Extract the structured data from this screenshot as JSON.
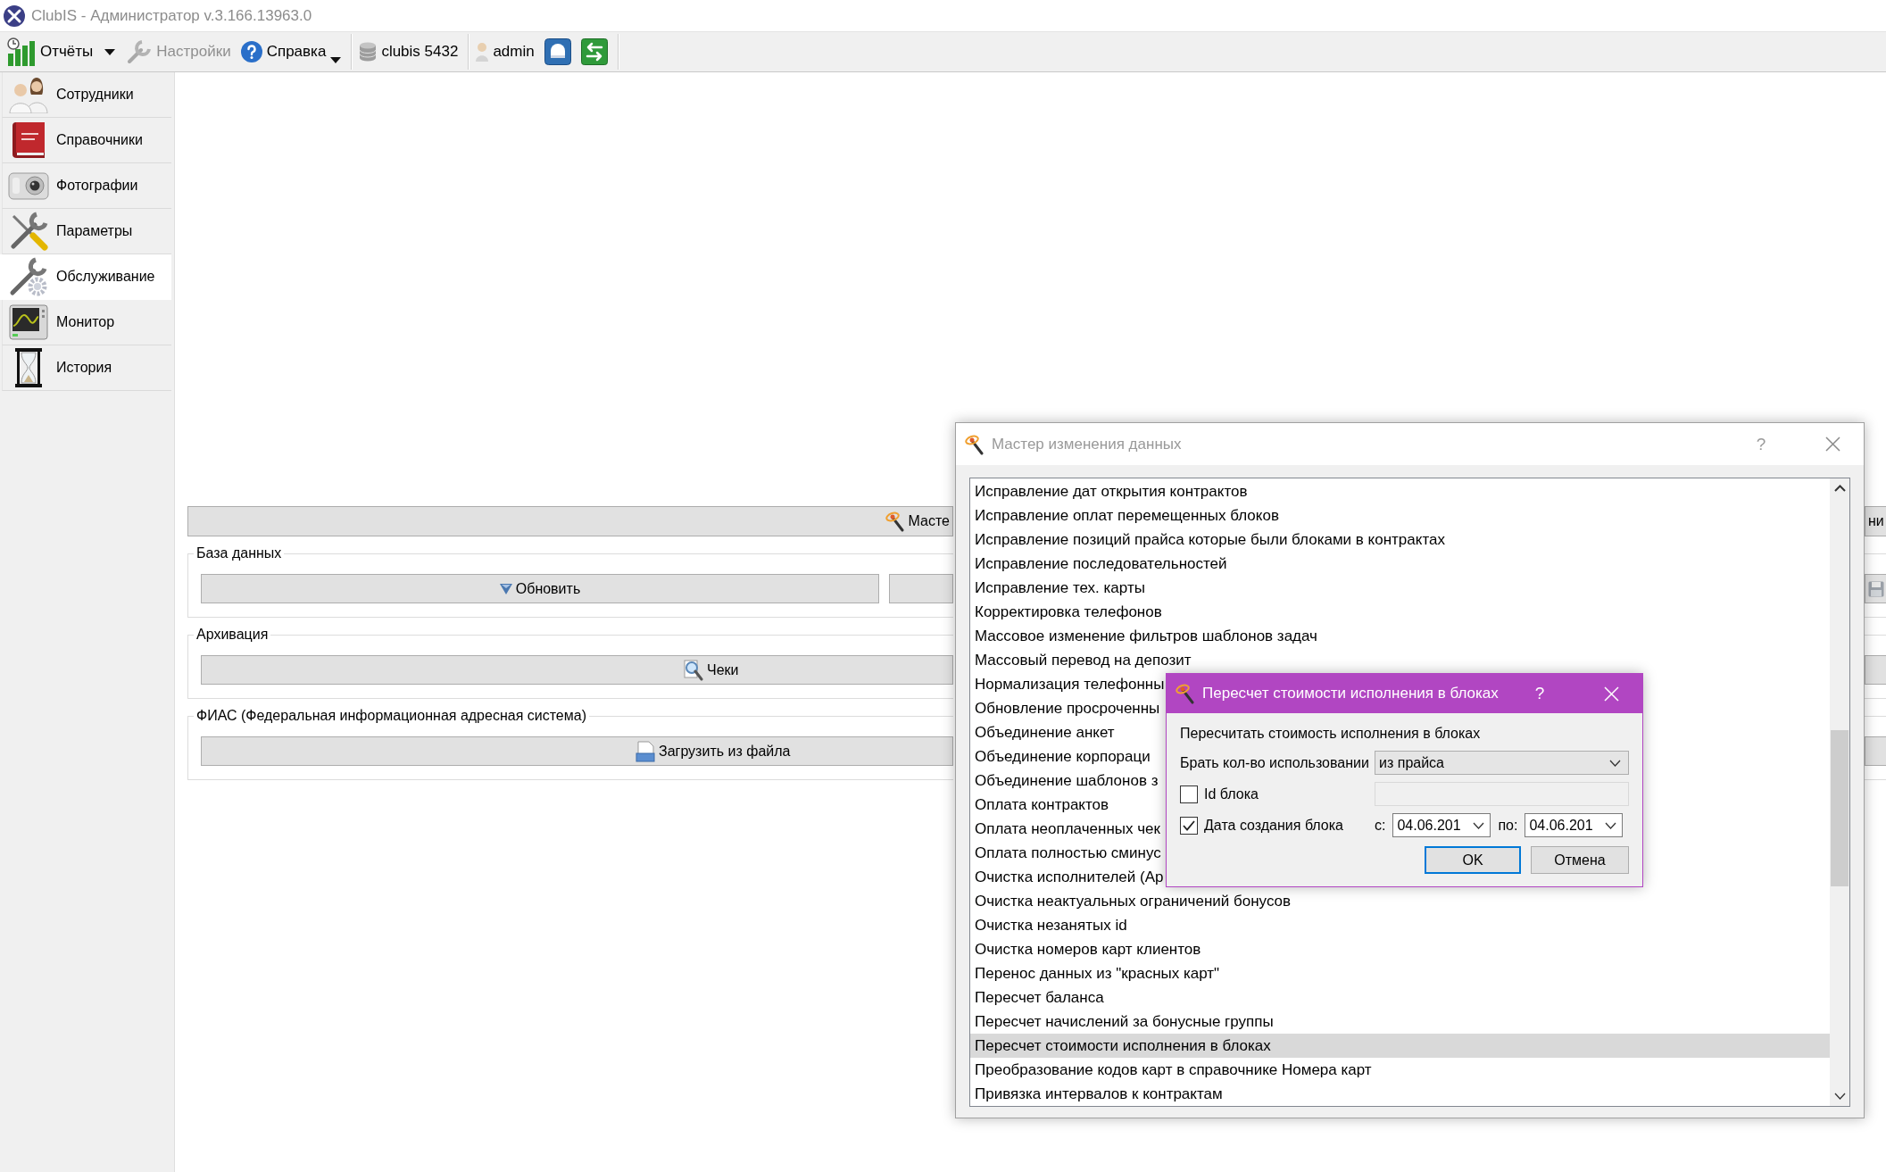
{
  "window": {
    "title": "ClubIS - Администратор v.3.166.13963.0"
  },
  "toolbar": {
    "groups": [
      {
        "items": [
          {
            "kind": "split",
            "label": "Отчёты",
            "disabled": false
          },
          {
            "kind": "button",
            "label": "Настройки",
            "disabled": true
          },
          {
            "kind": "menu",
            "label": "Справка",
            "disabled": false
          }
        ]
      },
      {
        "items": [
          {
            "kind": "button",
            "label": "clubis 5432",
            "disabled": false
          }
        ]
      },
      {
        "items": [
          {
            "kind": "button",
            "label": "admin",
            "disabled": false
          },
          {
            "kind": "icon",
            "disabled": false
          },
          {
            "kind": "icon",
            "disabled": false
          }
        ]
      }
    ]
  },
  "sidebar": {
    "items": [
      {
        "label": "Сотрудники",
        "selected": false
      },
      {
        "label": "Справочники",
        "selected": false
      },
      {
        "label": "Фотографии",
        "selected": false
      },
      {
        "label": "Параметры",
        "selected": false
      },
      {
        "label": "Обслуживание",
        "selected": true
      },
      {
        "label": "Монитор",
        "selected": false
      },
      {
        "label": "История",
        "selected": false
      }
    ]
  },
  "main_panel": {
    "rows": [
      {
        "kind": "buttons",
        "buttons": [
          {
            "kind": "text",
            "label": "Масте"
          },
          {
            "kind": "text",
            "label": "ни"
          }
        ]
      },
      {
        "kind": "group",
        "title": "База данных",
        "buttons": [
          {
            "kind": "text",
            "label": "Обновить"
          },
          {
            "kind": "blank"
          },
          {
            "kind": "icon"
          }
        ]
      },
      {
        "kind": "group",
        "title": "Архивация",
        "buttons": [
          {
            "kind": "text",
            "label": "Чеки"
          },
          {
            "kind": "blank"
          }
        ]
      },
      {
        "kind": "group",
        "title": "ФИАС (Федеральная информационная адресная система)",
        "buttons": [
          {
            "kind": "text",
            "label": "Загрузить из файла"
          },
          {
            "kind": "blank"
          }
        ]
      }
    ]
  },
  "wizard_dialog": {
    "title": "Мастер изменения данных",
    "active": false,
    "help_button": "?",
    "items": [
      {
        "label": "Исправление дат открытия контрактов",
        "selected": false
      },
      {
        "label": "Исправление оплат перемещенных блоков",
        "selected": false
      },
      {
        "label": "Исправление позиций прайса которые были блоками в контрактах",
        "selected": false
      },
      {
        "label": "Исправление последовательностей",
        "selected": false
      },
      {
        "label": "Исправление тех. карты",
        "selected": false
      },
      {
        "label": "Корректировка телефонов",
        "selected": false
      },
      {
        "label": "Массовое изменение фильтров шаблонов задач",
        "selected": false
      },
      {
        "label": "Массовый перевод на депозит",
        "selected": false
      },
      {
        "label": "Нормализация телефонны",
        "selected": false
      },
      {
        "label": "Обновление просроченны",
        "selected": false
      },
      {
        "label": "Объединение анкет",
        "selected": false
      },
      {
        "label": "Объединение корпораци",
        "selected": false
      },
      {
        "label": "Объединение шаблонов з",
        "selected": false
      },
      {
        "label": "Оплата контрактов",
        "selected": false
      },
      {
        "label": "Оплата неоплаченных чек",
        "selected": false
      },
      {
        "label": "Оплата полностью сминус",
        "selected": false
      },
      {
        "label": "Очистка исполнителей (Ар",
        "selected": false
      },
      {
        "label": "Очистка неактуальных ограничений бонусов",
        "selected": false
      },
      {
        "label": "Очистка незанятых id",
        "selected": false
      },
      {
        "label": "Очистка номеров карт клиентов",
        "selected": false
      },
      {
        "label": "Перенос данных из \"красных карт\"",
        "selected": false
      },
      {
        "label": "Пересчет баланса",
        "selected": false
      },
      {
        "label": "Пересчет начислений за бонусные группы",
        "selected": false
      },
      {
        "label": "Пересчет стоимости исполнения в блоках",
        "selected": true
      },
      {
        "label": "Преобразование кодов карт в справочнике Номера карт",
        "selected": false
      },
      {
        "label": "Привязка интервалов к контрактам",
        "selected": false
      }
    ]
  },
  "recalc_dialog": {
    "title": "Пересчет стоимости исполнения в блоках",
    "active": true,
    "help_button": "?",
    "description": "Пересчитать стоимость исполнения в блоках",
    "quantity_source": {
      "label": "Брать кол-во использовании",
      "value": "из прайса"
    },
    "block_id": {
      "label": "Id блока",
      "checked": false
    },
    "creation_date": {
      "label": "Дата создания блока",
      "checked": true,
      "from_label": "с:",
      "from_value": "04.06.201",
      "to_label": "по:",
      "to_value": "04.06.201"
    },
    "buttons": [
      {
        "label": "OK",
        "default": true
      },
      {
        "label": "Отмена",
        "default": false
      }
    ]
  }
}
